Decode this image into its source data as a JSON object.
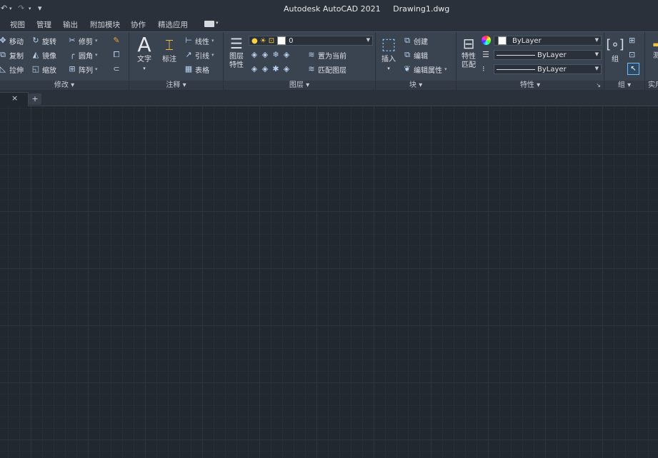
{
  "quick_access": {
    "undo": "↶",
    "redo": "↷",
    "customize": "▾"
  },
  "title": {
    "app": "Autodesk AutoCAD 2021",
    "file": "Drawing1.dwg"
  },
  "menus": [
    "视图",
    "管理",
    "输出",
    "附加模块",
    "协作",
    "精选应用"
  ],
  "ribbon": {
    "modify": {
      "label": "修改",
      "items": [
        "移动",
        "旋转",
        "修剪",
        "复制",
        "镜像",
        "圆角",
        "拉伸",
        "缩放",
        "阵列"
      ]
    },
    "annotation": {
      "label": "注释",
      "text": "文字",
      "dimension": "标注",
      "linear": "线性",
      "leader": "引线",
      "table": "表格"
    },
    "layers": {
      "label": "图层",
      "properties_line1": "图层",
      "properties_line2": "特性",
      "current_layer": "0",
      "make_current": "置为当前",
      "match_layer": "匹配图层"
    },
    "block": {
      "label": "块",
      "insert": "插入",
      "create": "创建",
      "edit": "编辑",
      "edit_attributes": "编辑属性"
    },
    "properties": {
      "label": "特性",
      "match_line1": "特性",
      "match_line2": "匹配",
      "color": "ByLayer",
      "lineweight": "ByLayer",
      "linetype": "ByLayer"
    },
    "groups": {
      "label": "组",
      "group": "组"
    },
    "utilities": {
      "label": "实用",
      "measure": "测"
    }
  },
  "tabs": {
    "close": "×",
    "new": "+"
  }
}
